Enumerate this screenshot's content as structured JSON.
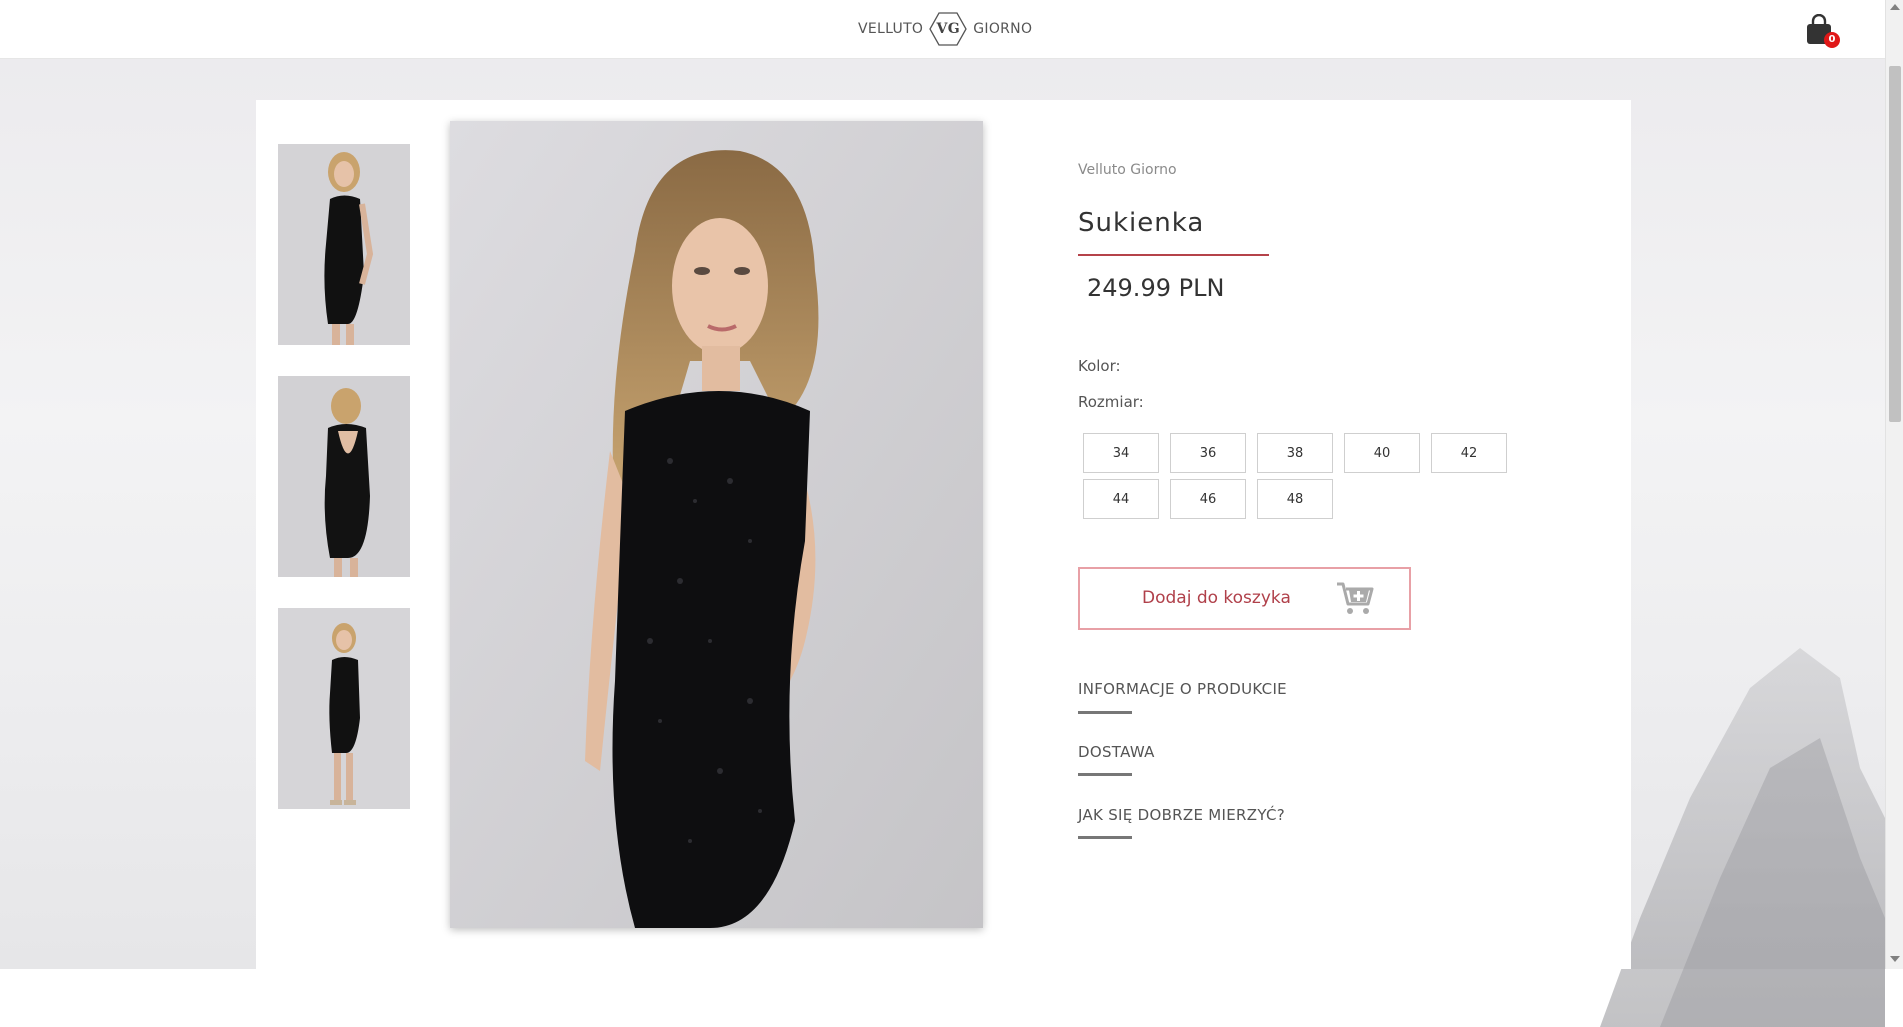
{
  "header": {
    "logo_left": "VELLUTO",
    "logo_mark": "VG",
    "logo_right": "GIORNO",
    "cart_count": "0"
  },
  "product": {
    "brand": "Velluto Giorno",
    "title": "Sukienka",
    "price": "249.99 PLN",
    "color_label": "Kolor:",
    "size_label": "Rozmiar:",
    "sizes": [
      "34",
      "36",
      "38",
      "40",
      "42",
      "44",
      "46",
      "48"
    ],
    "add_to_cart": "Dodaj do koszyka"
  },
  "sections": [
    "INFORMACJE O PRODUKCIE",
    "DOSTAWA",
    "JAK SIĘ DOBRZE MIERZYĆ?"
  ],
  "colors": {
    "accent": "#b5434a",
    "button_border": "#e8a0a6",
    "badge": "#e01818"
  }
}
